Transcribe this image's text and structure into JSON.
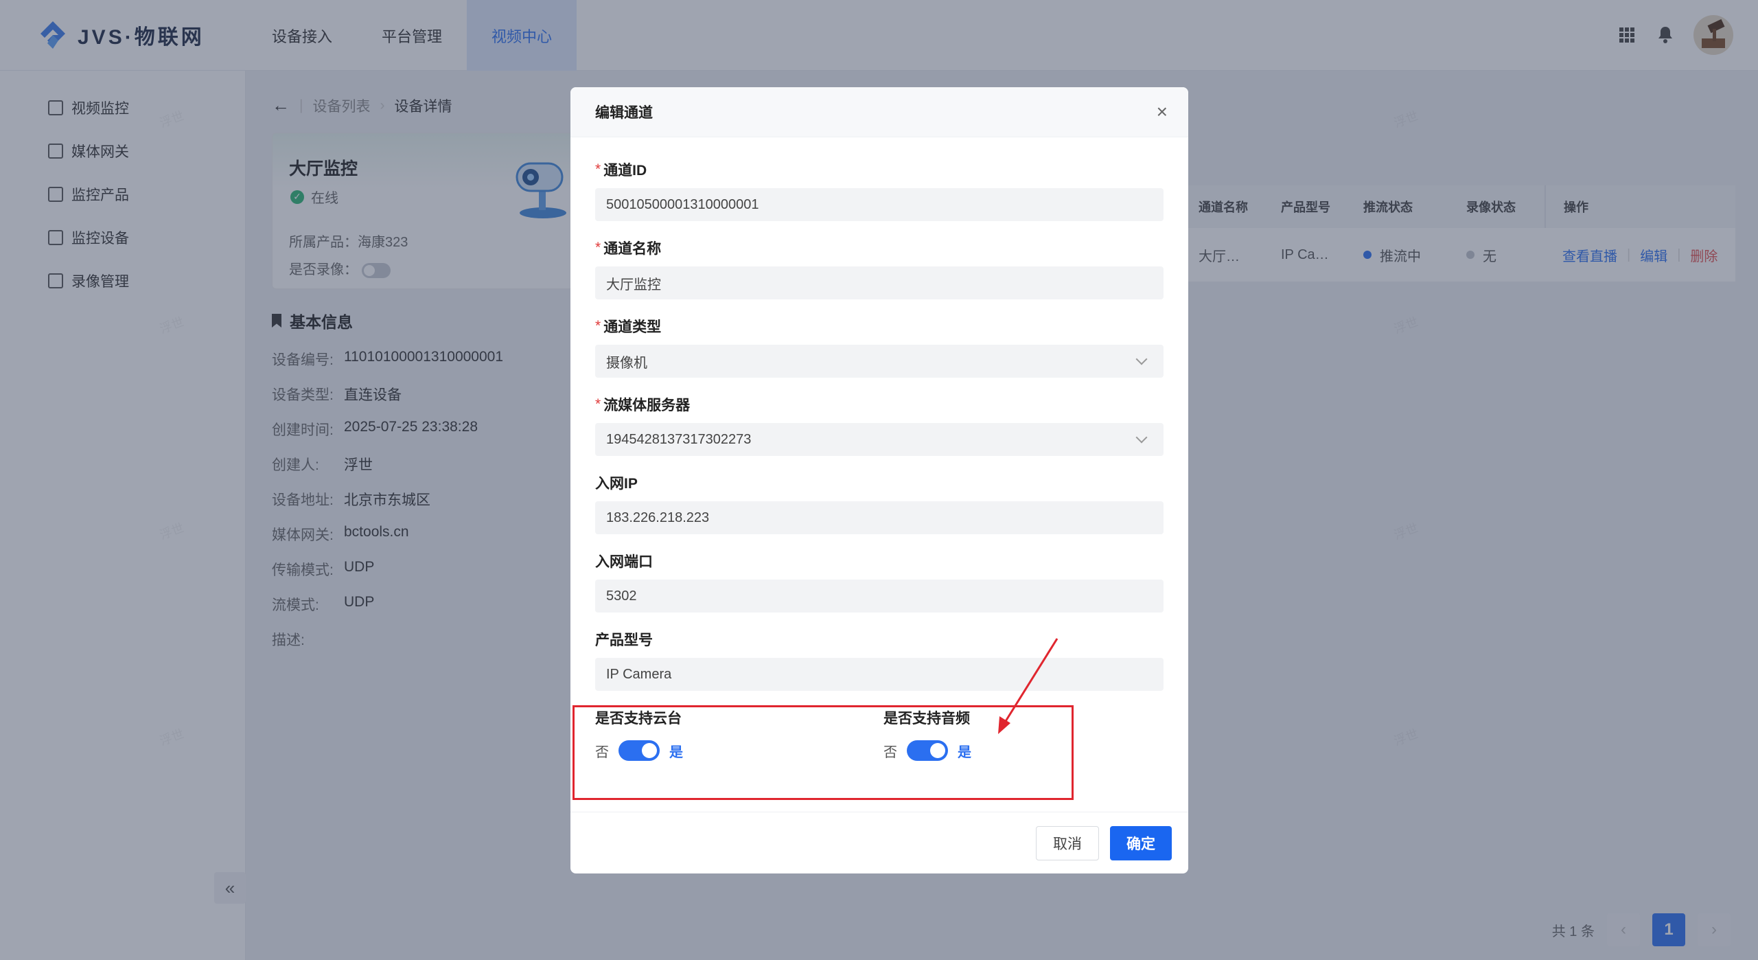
{
  "app": {
    "logo_text": "JVS·物联网"
  },
  "top_nav": [
    {
      "label": "设备接入"
    },
    {
      "label": "平台管理"
    },
    {
      "label": "视频中心"
    }
  ],
  "sidebar": {
    "items": [
      {
        "label": "视频监控",
        "icon": "video-monitor-icon"
      },
      {
        "label": "媒体网关",
        "icon": "media-gateway-icon"
      },
      {
        "label": "监控产品",
        "icon": "monitor-product-icon"
      },
      {
        "label": "监控设备",
        "icon": "monitor-device-icon"
      },
      {
        "label": "录像管理",
        "icon": "record-icon"
      }
    ],
    "collapse": "«"
  },
  "breadcrumb": {
    "back": "←",
    "parent": "设备列表",
    "current": "设备详情"
  },
  "device": {
    "name": "大厅监控",
    "status": "在线",
    "product_label": "所属产品：",
    "product_value": "海康323",
    "record_label": "是否录像："
  },
  "basic_info": {
    "title": "基本信息",
    "rows": [
      {
        "k": "设备编号:",
        "v": "11010100001310000001"
      },
      {
        "k": "设备类型:",
        "v": "直连设备"
      },
      {
        "k": "创建时间:",
        "v": "2025-07-25 23:38:28"
      },
      {
        "k": "创建人:",
        "v": "浮世"
      },
      {
        "k": "设备地址:",
        "v": "北京市东城区"
      },
      {
        "k": "媒体网关:",
        "v": "bctools.cn"
      },
      {
        "k": "传输模式:",
        "v": "UDP"
      },
      {
        "k": "流模式:",
        "v": "UDP"
      },
      {
        "k": "描述:",
        "v": ""
      }
    ]
  },
  "table": {
    "headers": [
      "通道名称",
      "产品型号",
      "推流状态",
      "录像状态",
      "操作"
    ],
    "row": {
      "name": "大厅…",
      "model": "IP Ca…",
      "push_status": "推流中",
      "record_status": "无",
      "actions": [
        "查看直播",
        "编辑",
        "删除"
      ]
    }
  },
  "pager": {
    "total": "共 1 条",
    "prev": "‹",
    "page": "1",
    "next": "›"
  },
  "watermark": "浮世",
  "modal": {
    "title": "编辑通道",
    "close": "×",
    "fields": {
      "channel_id": {
        "label": "通道ID",
        "value": "50010500001310000001"
      },
      "channel_name": {
        "label": "通道名称",
        "value": "大厅监控"
      },
      "channel_type": {
        "label": "通道类型",
        "value": "摄像机"
      },
      "media_server": {
        "label": "流媒体服务器",
        "value": "1945428137317302273"
      },
      "net_ip": {
        "label": "入网IP",
        "value": "183.226.218.223"
      },
      "net_port": {
        "label": "入网端口",
        "value": "5302"
      },
      "product_model": {
        "label": "产品型号",
        "value": "IP Camera"
      }
    },
    "ptz": {
      "label": "是否支持云台",
      "no": "否",
      "yes": "是",
      "on": true
    },
    "audio": {
      "label": "是否支持音频",
      "no": "否",
      "yes": "是",
      "on": true
    },
    "cancel": "取消",
    "ok": "确定"
  },
  "colors": {
    "primary": "#2b6ff0",
    "annotation": "#e0262f",
    "required": "#e03b3b"
  }
}
